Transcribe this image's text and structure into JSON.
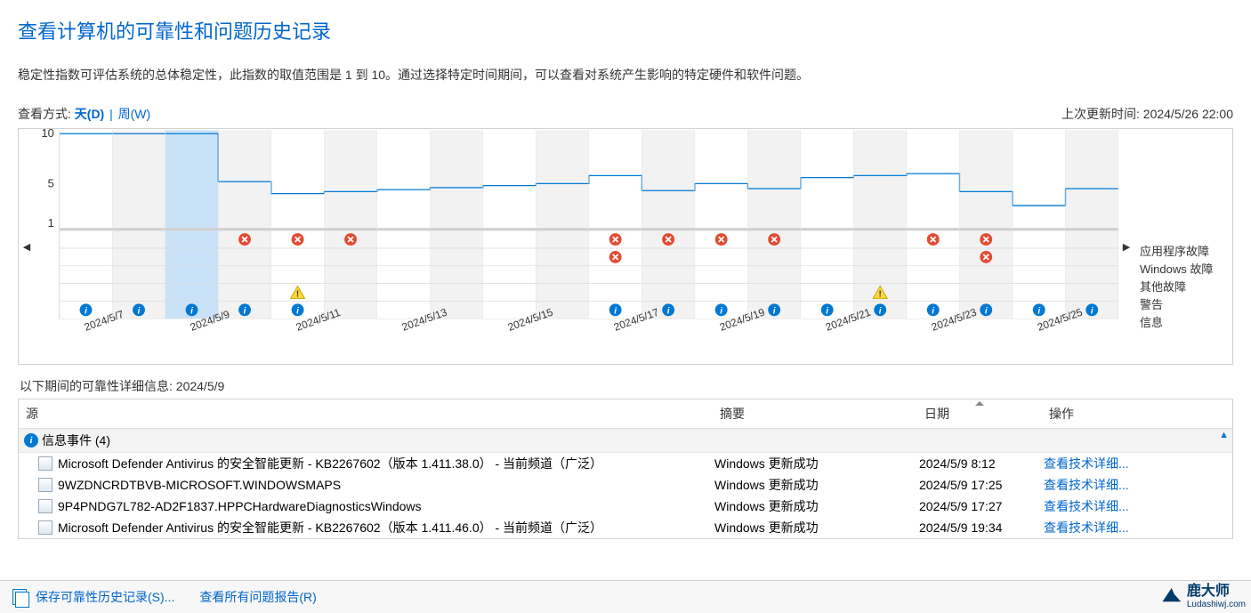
{
  "header": {
    "title": "查看计算机的可靠性和问题历史记录",
    "description": "稳定性指数可评估系统的总体稳定性，此指数的取值范围是 1 到 10。通过选择特定时间期间，可以查看对系统产生影响的特定硬件和软件问题。"
  },
  "controls": {
    "view_by_label": "查看方式:",
    "day_label": "天(D)",
    "week_label": "周(W)",
    "separator": "|",
    "last_update_label": "上次更新时间:",
    "last_update_value": "2024/5/26 22:00"
  },
  "chart_data": {
    "type": "line",
    "ylabel": "",
    "ylim": [
      1,
      10
    ],
    "y_ticks": [
      1,
      5,
      10
    ],
    "selected_date": "2024/5/9",
    "dates": [
      "2024/5/7",
      "2024/5/8",
      "2024/5/9",
      "2024/5/10",
      "2024/5/11",
      "2024/5/12",
      "2024/5/13",
      "2024/5/14",
      "2024/5/15",
      "2024/5/16",
      "2024/5/17",
      "2024/5/18",
      "2024/5/19",
      "2024/5/20",
      "2024/5/21",
      "2024/5/22",
      "2024/5/23",
      "2024/5/24",
      "2024/5/25",
      "2024/5/26"
    ],
    "values": [
      10,
      10,
      10,
      5.2,
      4.0,
      4.2,
      4.4,
      4.6,
      4.8,
      5.0,
      5.8,
      4.3,
      5.0,
      4.5,
      5.6,
      5.8,
      6.0,
      4.2,
      2.8,
      4.5
    ],
    "event_rows": [
      {
        "name": "应用程序故障",
        "type": "error",
        "cells": [
          false,
          false,
          false,
          true,
          true,
          true,
          false,
          false,
          false,
          false,
          true,
          true,
          true,
          true,
          false,
          false,
          true,
          true,
          false,
          false
        ]
      },
      {
        "name": "Windows 故障",
        "type": "error",
        "cells": [
          false,
          false,
          false,
          false,
          false,
          false,
          false,
          false,
          false,
          false,
          true,
          false,
          false,
          false,
          false,
          false,
          false,
          true,
          false,
          false
        ]
      },
      {
        "name": "其他故障",
        "type": "none",
        "cells": [
          false,
          false,
          false,
          false,
          false,
          false,
          false,
          false,
          false,
          false,
          false,
          false,
          false,
          false,
          false,
          false,
          false,
          false,
          false,
          false
        ]
      },
      {
        "name": "警告",
        "type": "warn",
        "cells": [
          false,
          false,
          false,
          false,
          true,
          false,
          false,
          false,
          false,
          false,
          false,
          false,
          false,
          false,
          false,
          true,
          false,
          false,
          false,
          false
        ]
      },
      {
        "name": "信息",
        "type": "info",
        "cells": [
          true,
          true,
          true,
          true,
          true,
          false,
          false,
          false,
          false,
          false,
          true,
          true,
          true,
          true,
          true,
          true,
          true,
          true,
          true,
          true
        ]
      }
    ],
    "legend": [
      "应用程序故障",
      "Windows 故障",
      "其他故障",
      "警告",
      "信息"
    ]
  },
  "details": {
    "label_prefix": "以下期间的可靠性详细信息:",
    "date": "2024/5/9"
  },
  "table": {
    "columns": {
      "source": "源",
      "summary": "摘要",
      "date": "日期",
      "action": "操作"
    },
    "group_label": "信息事件 (4)",
    "action_link": "查看技术详细...",
    "rows": [
      {
        "source": "Microsoft Defender Antivirus 的安全智能更新 - KB2267602（版本 1.411.38.0） - 当前频道（广泛）",
        "summary": "Windows 更新成功",
        "date": "2024/5/9 8:12"
      },
      {
        "source": "9WZDNCRDTBVB-MICROSOFT.WINDOWSMAPS",
        "summary": "Windows 更新成功",
        "date": "2024/5/9 17:25"
      },
      {
        "source": "9P4PNDG7L782-AD2F1837.HPPCHardwareDiagnosticsWindows",
        "summary": "Windows 更新成功",
        "date": "2024/5/9 17:27"
      },
      {
        "source": "Microsoft Defender Antivirus 的安全智能更新 - KB2267602（版本 1.411.46.0） - 当前频道（广泛）",
        "summary": "Windows 更新成功",
        "date": "2024/5/9 19:34"
      }
    ]
  },
  "footer": {
    "save_history": "保存可靠性历史记录(S)...",
    "view_all_reports": "查看所有问题报告(R)"
  },
  "watermark": {
    "brand": "鹿大师",
    "url": "Ludashiwj.com"
  }
}
